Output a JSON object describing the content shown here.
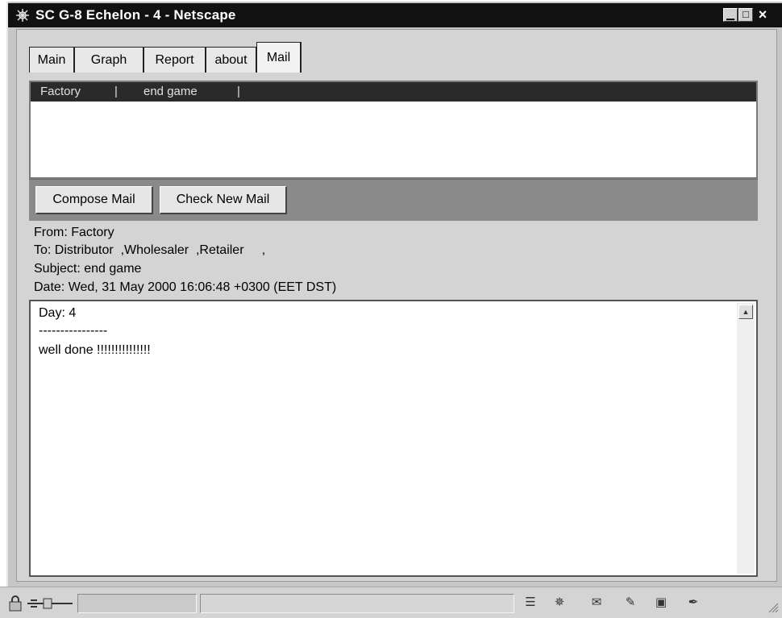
{
  "window": {
    "title": "SC G-8 Echelon - 4 - Netscape",
    "minimize_glyph": "▁",
    "maximize_glyph": "□",
    "close_glyph": "×"
  },
  "tabs": [
    {
      "label": "Main",
      "active": false
    },
    {
      "label": "Graph",
      "active": false
    },
    {
      "label": "Report",
      "active": false
    },
    {
      "label": "about",
      "active": false
    },
    {
      "label": "Mail",
      "active": true
    }
  ],
  "message_list": {
    "rows": [
      {
        "from": "Factory",
        "separator1": "|",
        "subject": "end game",
        "separator2": "|"
      }
    ]
  },
  "toolbar": {
    "compose_label": "Compose Mail",
    "check_label": "Check New Mail"
  },
  "message": {
    "from_line": "From: Factory",
    "to_line": "To: Distributor  ,Wholesaler  ,Retailer     ,",
    "subject_line": "Subject: end game",
    "date_line": "Date: Wed, 31 May 2000 16:06:48 +0300 (EET DST)",
    "body": {
      "line1": "Day: 4",
      "line2": "----------------",
      "line3": "well done !!!!!!!!!!!!!!!"
    }
  },
  "statusbar": {
    "icons": [
      "lock-icon",
      "plug-icon",
      "document-icon",
      "navigator-icon",
      "mail-icon",
      "discussion-icon",
      "composer-icon",
      "pen-icon"
    ]
  },
  "colors": {
    "titlebar": "#111111",
    "list_header": "#2a2a2a",
    "toolbar": "#8a8a8a",
    "chrome": "#d4d4d4"
  }
}
